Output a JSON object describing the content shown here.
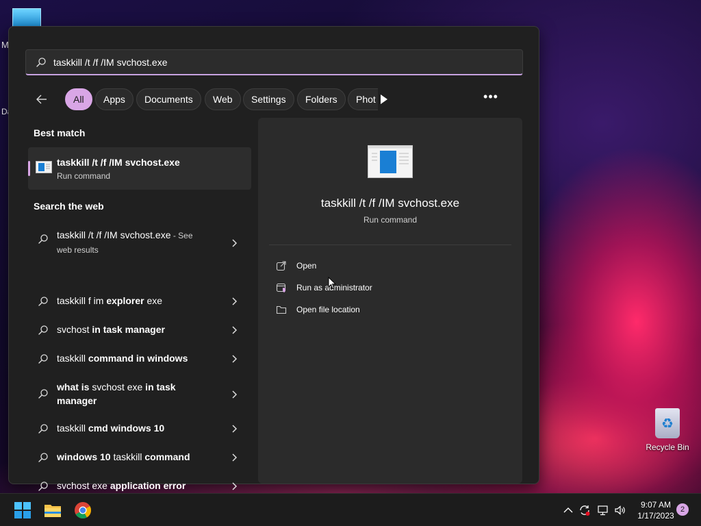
{
  "search": {
    "value": "taskkill /t /f /IM svchost.exe",
    "icon": "search-icon"
  },
  "filters": {
    "chips": [
      "All",
      "Apps",
      "Documents",
      "Web",
      "Settings",
      "Folders",
      "Phot"
    ],
    "active": "All"
  },
  "best_match": {
    "heading": "Best match",
    "title": "taskkill /t /f /IM svchost.exe",
    "subtitle": "Run command"
  },
  "web": {
    "heading": "Search the web",
    "items": [
      {
        "query_normal": "taskkill /t /f /IM svchost.exe",
        "query_bold": "",
        "suffix": " - See web results"
      },
      {
        "query_normal": "taskkill f im ",
        "query_bold": "explorer",
        "tail_normal": " exe"
      },
      {
        "query_normal": "svchost",
        "query_bold": " in task manager"
      },
      {
        "query_normal": "taskkill",
        "query_bold": " command in windows"
      },
      {
        "query_bold_pre": "what is ",
        "query_normal": "svchost exe",
        "query_bold": " in task manager"
      },
      {
        "query_normal": "taskkill",
        "query_bold": " cmd windows 10"
      },
      {
        "query_bold_pre": "windows 10 ",
        "query_normal": "taskkill",
        "query_bold": " command"
      },
      {
        "query_normal": "svchost exe",
        "query_bold": " application error"
      }
    ]
  },
  "preview": {
    "title": "taskkill /t /f /IM svchost.exe",
    "subtitle": "Run command",
    "actions": [
      {
        "label": "Open",
        "icon": "open-external-icon"
      },
      {
        "label": "Run as administrator",
        "icon": "shield-admin-icon"
      },
      {
        "label": "Open file location",
        "icon": "folder-icon"
      }
    ]
  },
  "desktop": {
    "recycle_bin_label": "Recycle Bin",
    "edge_fragment_1": "M",
    "edge_fragment_2": "Da"
  },
  "taskbar": {
    "time": "9:07 AM",
    "date": "1/17/2023",
    "notification_count": "2"
  },
  "colors": {
    "accent": "#d9a6e6",
    "panel": "#202020",
    "preview": "#2b2b2b"
  }
}
